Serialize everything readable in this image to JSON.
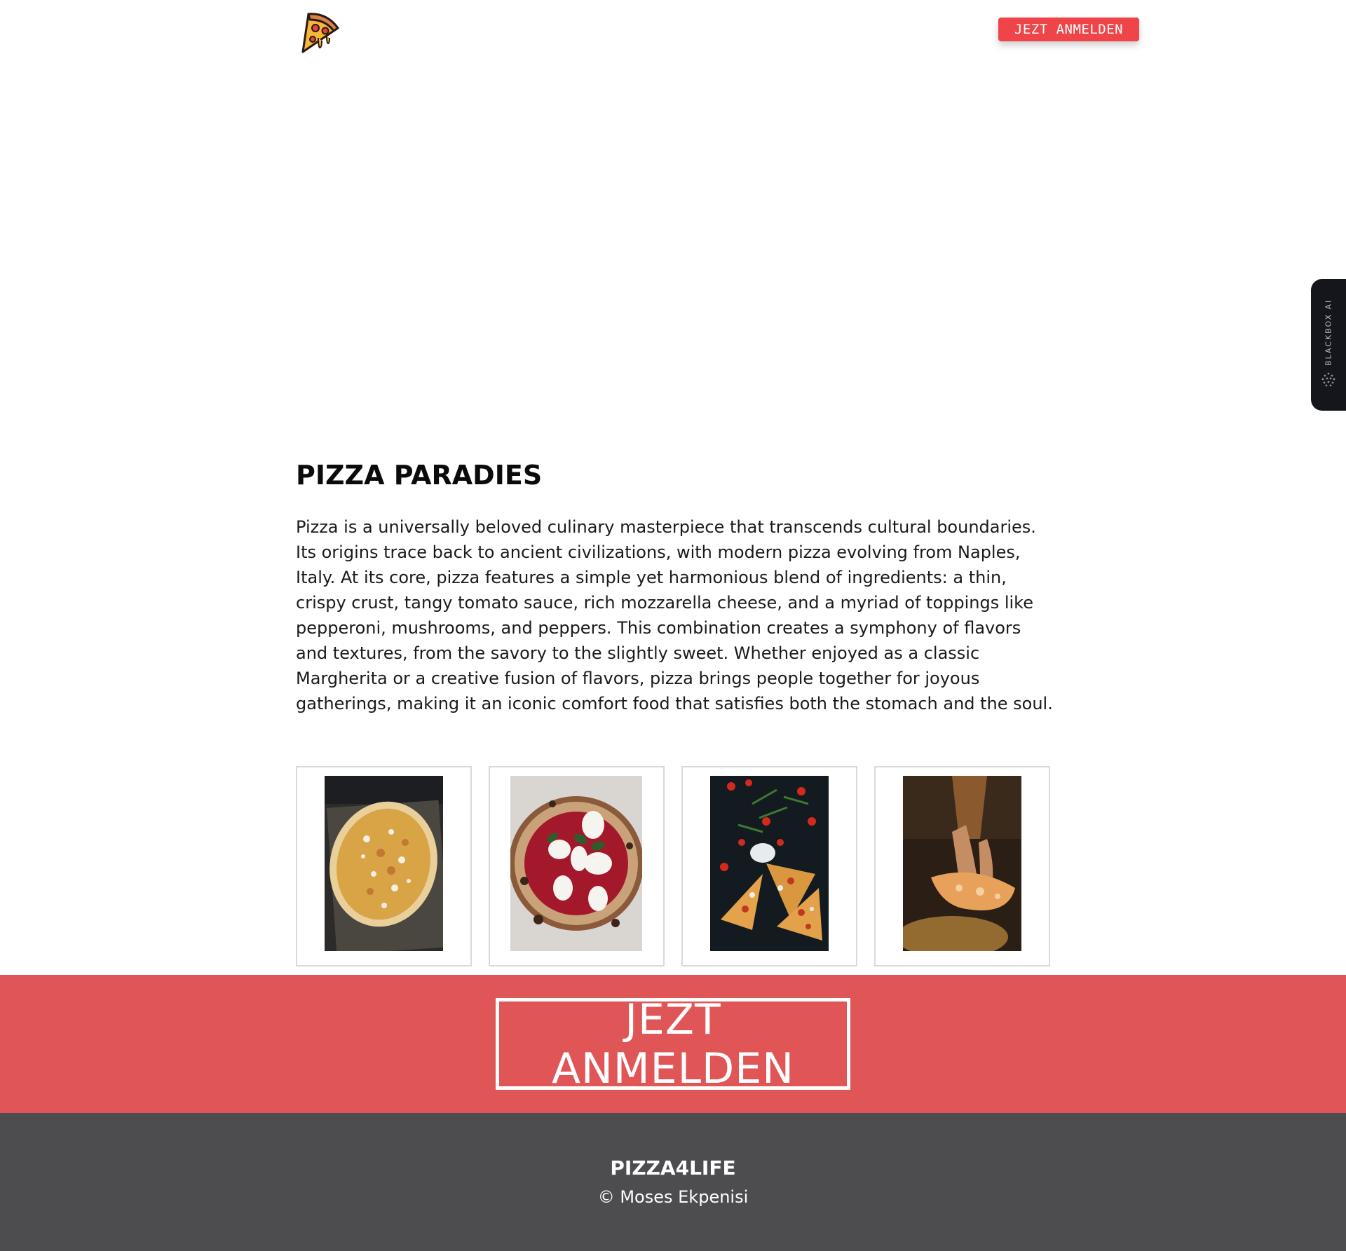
{
  "header": {
    "logo_icon": "pizza-slice-icon",
    "signup_label": "JEZT ANMELDEN",
    "signup_color": "#ef4448"
  },
  "side_tab": {
    "label": "BLACKBOX AI",
    "icon": "dots-grid-icon"
  },
  "main": {
    "title": "PIZZA PARADIES",
    "description": "Pizza is a universally beloved culinary masterpiece that transcends cultural boundaries. Its origins trace back to ancient civilizations, with modern pizza evolving from Naples, Italy. At its core, pizza features a simple yet harmonious blend of ingredients: a thin, crispy crust, tangy tomato sauce, rich mozzarella cheese, and a myriad of toppings like pepperoni, mushrooms, and peppers. This combination creates a symphony of flavors and textures, from the savory to the slightly sweet. Whether enjoyed as a classic Margherita or a creative fusion of flavors, pizza brings people together for joyous gatherings, making it an iconic comfort food that satisfies both the stomach and the soul."
  },
  "gallery": {
    "images": [
      "pizza-on-tray-photo",
      "margherita-pizza-photo",
      "pizza-slices-tomatoes-photo",
      "hands-holding-pizza-photo"
    ]
  },
  "cta": {
    "label": "JEZT ANMELDEN",
    "band_color": "#e05556"
  },
  "footer": {
    "brand": "PIZZA4LIFE",
    "copyright": "© Moses Ekpenisi",
    "background": "#4d4d4f"
  }
}
